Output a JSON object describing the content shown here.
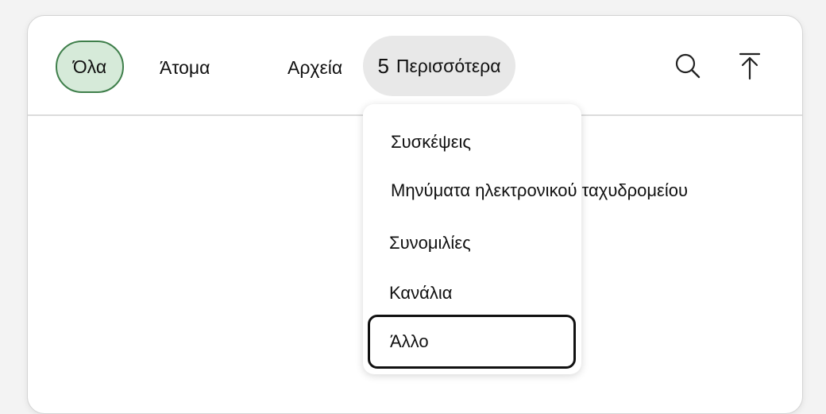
{
  "tabs": {
    "all": "Όλα",
    "people": "Άτομα",
    "files": "Αρχεία",
    "more_count": "5",
    "more_label": "Περισσότερα"
  },
  "icons": {
    "search": "search-icon",
    "upload": "upload-icon"
  },
  "menu": {
    "items": [
      "Συσκέψεις",
      "Μηνύματα ηλεκτρονικού ταχυδρομείου",
      "Συνομιλίες",
      "Κανάλια",
      "Άλλο"
    ]
  },
  "colors": {
    "selected_tab_background": "#d6ead9",
    "selected_tab_border": "#3f7f4b",
    "more_tab_background": "#e8e8e8",
    "focus_border": "#111111"
  }
}
